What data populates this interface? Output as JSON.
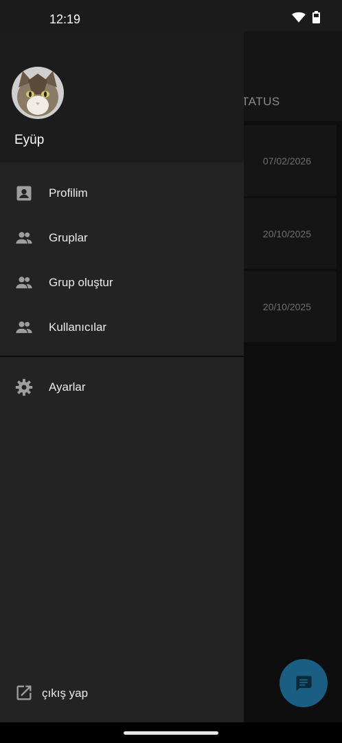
{
  "status_bar": {
    "time": "12:19",
    "icons": [
      "wifi-icon",
      "battery-icon"
    ]
  },
  "background_app": {
    "tab_label": "TATUS",
    "rows": [
      {
        "date": "07/02/2026"
      },
      {
        "date": "20/10/2025"
      },
      {
        "date": "20/10/2025"
      }
    ],
    "fab_icon": "chat-icon"
  },
  "drawer": {
    "user_name": "Eyüp",
    "menu": [
      {
        "label": "Profilim",
        "icon": "account-box-icon"
      },
      {
        "label": "Gruplar",
        "icon": "group-icon"
      },
      {
        "label": "Grup oluştur",
        "icon": "group-add-icon"
      },
      {
        "label": "Kullanıcılar",
        "icon": "people-icon"
      }
    ],
    "settings": {
      "label": "Ayarlar",
      "icon": "gear-icon"
    },
    "logout": {
      "label": "çıkış yap",
      "icon": "open-in-new-icon"
    }
  },
  "colors": {
    "drawer_bg": "#232323",
    "header_bg": "#1c1c1c",
    "icon_gray": "#9e9e9e",
    "fab": "#1b5e84"
  }
}
